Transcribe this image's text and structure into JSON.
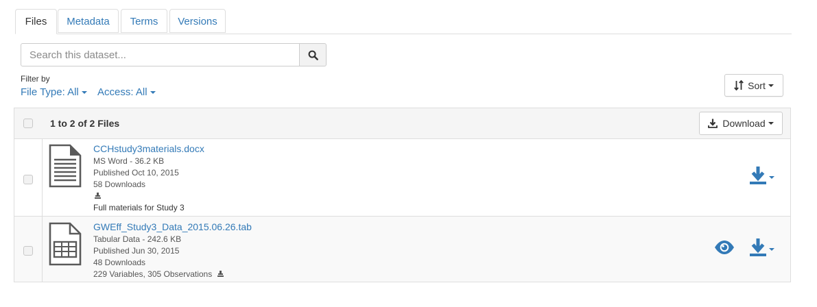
{
  "tabs": [
    {
      "label": "Files"
    },
    {
      "label": "Metadata"
    },
    {
      "label": "Terms"
    },
    {
      "label": "Versions"
    }
  ],
  "search": {
    "placeholder": "Search this dataset...",
    "button_icon": "search-icon"
  },
  "filters": {
    "label": "Filter by",
    "file_type": "File Type: All",
    "access": "Access: All"
  },
  "sort": {
    "label": "Sort",
    "icon": "sort-icon"
  },
  "table": {
    "count_label": "1 to 2 of 2 Files",
    "download_label": "Download",
    "files": [
      {
        "name": "CCHstudy3materials.docx",
        "type_size": "MS Word - 36.2 KB",
        "published": "Published Oct 10, 2015",
        "downloads": "58 Downloads",
        "description": "Full materials for Study 3",
        "icon": "document-icon"
      },
      {
        "name": "GWEff_Study3_Data_2015.06.26.tab",
        "type_size": "Tabular Data - 242.6 KB",
        "published": "Published Jun 30, 2015",
        "downloads": "48 Downloads",
        "variables": "229 Variables, 305 Observations",
        "icon": "tabular-data-icon"
      }
    ]
  },
  "colors": {
    "link": "#337ab7",
    "header_bg": "#f5f5f5",
    "border": "#dddddd"
  }
}
